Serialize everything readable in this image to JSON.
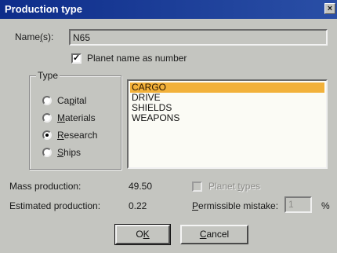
{
  "title": "Production type",
  "close_glyph": "×",
  "names_label_pre": "Name",
  "names_label_acc": "(",
  "names_label_post": "s):",
  "names_value": "N65",
  "planet_name_label": "Planet name as number",
  "planet_name_checked": true,
  "type_group": {
    "legend": "Type",
    "options": [
      {
        "pre": "Ca",
        "acc": "p",
        "post": "ital",
        "selected": false
      },
      {
        "pre": "",
        "acc": "M",
        "post": "aterials",
        "selected": false
      },
      {
        "pre": "",
        "acc": "R",
        "post": "esearch",
        "selected": true
      },
      {
        "pre": "",
        "acc": "S",
        "post": "hips",
        "selected": false
      }
    ]
  },
  "list_items": [
    {
      "label": "CARGO",
      "selected": true
    },
    {
      "label": "DRIVE",
      "selected": false
    },
    {
      "label": "SHIELDS",
      "selected": false
    },
    {
      "label": "WEAPONS",
      "selected": false
    }
  ],
  "mass_production_label": "Mass production:",
  "mass_production_value": "49.50",
  "planet_types_pre": "Planet ",
  "planet_types_acc": "t",
  "planet_types_post": "ypes",
  "estimated_label": "Estimated production:",
  "estimated_value": "0.22",
  "permissible_acc": "P",
  "permissible_post": "ermissible mistake:",
  "permissible_value": "1",
  "percent_sign": "%",
  "ok_pre": "O",
  "ok_acc": "K",
  "ok_post": "",
  "cancel_pre": "",
  "cancel_acc": "C",
  "cancel_post": "ancel"
}
